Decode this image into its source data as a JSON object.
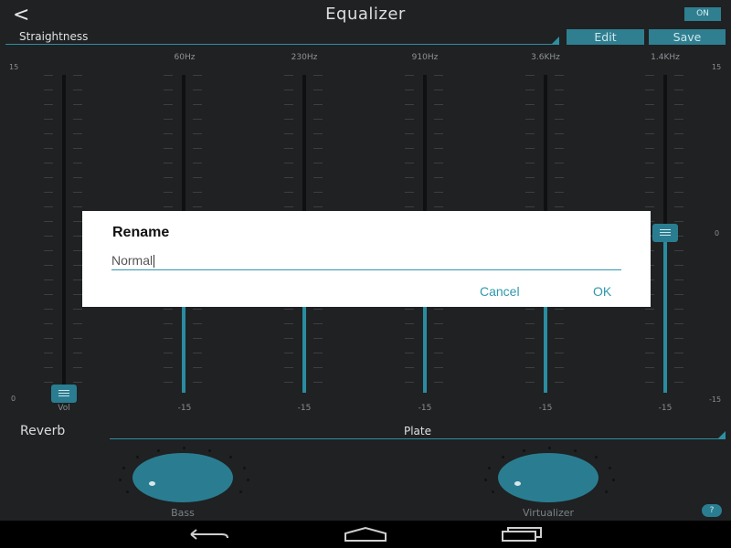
{
  "header": {
    "back_icon": "back-chevron-icon",
    "title": "Equalizer",
    "power_label": "ON",
    "preset_name": "Straightness",
    "edit_label": "Edit",
    "save_label": "Save"
  },
  "equalizer": {
    "scale_left": {
      "top": "15",
      "bottom": "0"
    },
    "scale_right": {
      "top": "15",
      "middle": "0",
      "bottom": "-15"
    },
    "bands": [
      {
        "freq": "",
        "bottom_label": "Vol",
        "level_fraction": 0.0
      },
      {
        "freq": "60Hz",
        "bottom_label": "-15",
        "level_fraction": 0.5
      },
      {
        "freq": "230Hz",
        "bottom_label": "-15",
        "level_fraction": 0.5
      },
      {
        "freq": "910Hz",
        "bottom_label": "-15",
        "level_fraction": 0.5
      },
      {
        "freq": "3.6KHz",
        "bottom_label": "-15",
        "level_fraction": 0.5
      },
      {
        "freq": "1.4KHz",
        "bottom_label": "-15",
        "level_fraction": 0.5
      }
    ]
  },
  "reverb": {
    "label": "Reverb",
    "value": "Plate"
  },
  "knobs": {
    "bass_label": "Bass",
    "virtualizer_label": "Virtualizer"
  },
  "help_label": "?",
  "nav": {
    "back": "back-icon",
    "home": "home-icon",
    "recents": "recents-icon"
  },
  "dialog": {
    "title": "Rename",
    "input_value": "Normal",
    "cancel_label": "Cancel",
    "ok_label": "OK"
  },
  "colors": {
    "accent": "#2a7d90",
    "background": "#1f2123"
  }
}
